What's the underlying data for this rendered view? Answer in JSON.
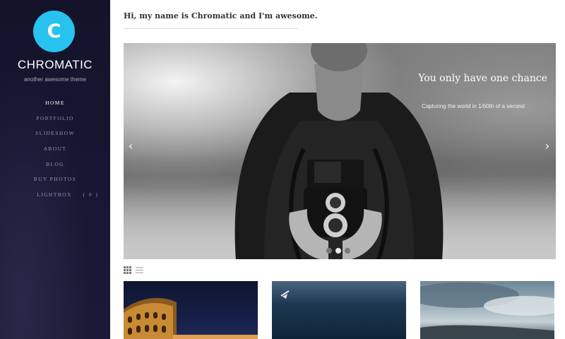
{
  "site": {
    "logo_letter": "C",
    "title": "CHROMATIC",
    "tagline": "another awesome theme",
    "accent_color": "#27c2ee"
  },
  "nav": {
    "items": [
      {
        "label": "HOME",
        "active": true
      },
      {
        "label": "PORTFOLIO",
        "active": false
      },
      {
        "label": "SLIDESHOW",
        "active": false
      },
      {
        "label": "ABOUT",
        "active": false
      },
      {
        "label": "BLOG",
        "active": false
      },
      {
        "label": "BUY PHOTOS",
        "active": false
      }
    ],
    "lightbox": {
      "label": "LIGHTBOX",
      "count": "( 0 )"
    }
  },
  "main": {
    "heading": "Hi, my name is Chromatic and I'm awesome."
  },
  "slider": {
    "title": "You only have one chance",
    "caption": "Capturing the world in 1/60th of a second",
    "prev_icon": "chevron-left-icon",
    "next_icon": "chevron-right-icon",
    "slide_count": 3,
    "active_slide": 2
  },
  "gallery": {
    "view_icons": [
      "grid-view-icon",
      "list-view-icon"
    ],
    "thumbnails": [
      "colosseum-night-photo",
      "bird-over-water-photo",
      "clouds-sky-photo"
    ]
  }
}
